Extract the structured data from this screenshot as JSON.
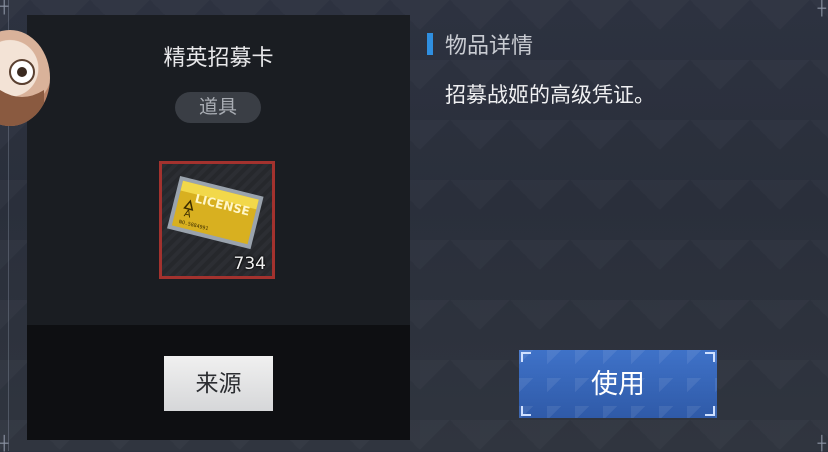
{
  "item": {
    "name": "精英招募卡",
    "type": "道具",
    "count": "734",
    "frame_color": "#a3322e",
    "card_text": "LICENSE",
    "card_grade": "A",
    "card_serial": "NO.5884991"
  },
  "left_actions": {
    "source_label": "来源"
  },
  "details": {
    "title": "物品详情",
    "description": "招募战姬的高级凭证。"
  },
  "right_actions": {
    "use_label": "使用"
  },
  "colors": {
    "accent_blue": "#2f8fe0",
    "use_button": "#3a68bb"
  }
}
